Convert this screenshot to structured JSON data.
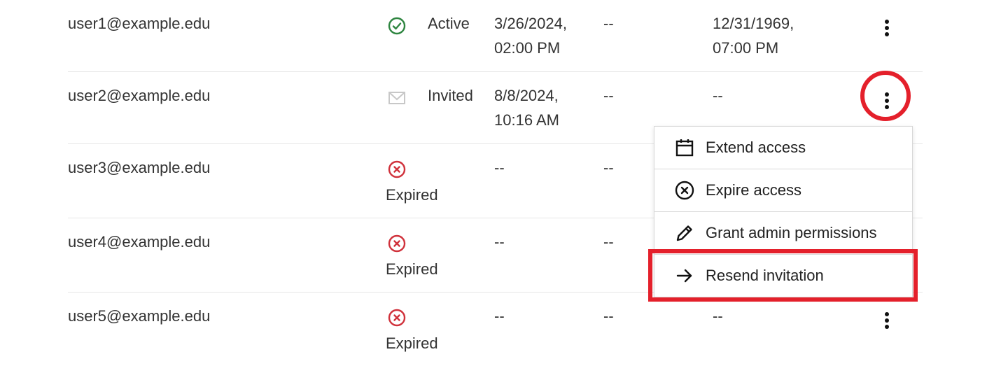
{
  "users": [
    {
      "email": "user1@example.edu",
      "status": "Active",
      "status_icon": "check-circle-icon",
      "created_line1": "3/26/2024,",
      "created_line2": "02:00 PM",
      "col4": "--",
      "expires_line1": "12/31/1969,",
      "expires_line2": "07:00 PM"
    },
    {
      "email": "user2@example.edu",
      "status": "Invited",
      "status_icon": "envelope-icon",
      "created_line1": "8/8/2024,",
      "created_line2": "10:16 AM",
      "col4": "--",
      "expires_line1": "--",
      "expires_line2": ""
    },
    {
      "email": "user3@example.edu",
      "status": "Expired",
      "status_icon": "x-circle-icon",
      "created_line1": "--",
      "created_line2": "",
      "col4": "--",
      "expires_line1": "",
      "expires_line2": ""
    },
    {
      "email": "user4@example.edu",
      "status": "Expired",
      "status_icon": "x-circle-icon",
      "created_line1": "--",
      "created_line2": "",
      "col4": "--",
      "expires_line1": "",
      "expires_line2": ""
    },
    {
      "email": "user5@example.edu",
      "status": "Expired",
      "status_icon": "x-circle-icon",
      "created_line1": "--",
      "created_line2": "",
      "col4": "--",
      "expires_line1": "--",
      "expires_line2": ""
    }
  ],
  "menu": {
    "items": [
      {
        "label": "Extend access",
        "icon": "calendar-icon"
      },
      {
        "label": "Expire access",
        "icon": "x-circle-icon"
      },
      {
        "label": "Grant admin permissions",
        "icon": "pencil-icon"
      },
      {
        "label": "Resend invitation",
        "icon": "arrow-right-icon"
      }
    ]
  },
  "colors": {
    "active": "#2e8540",
    "expired": "#d0313b",
    "invited": "#c8c8c8",
    "annotation": "#e4202b"
  }
}
